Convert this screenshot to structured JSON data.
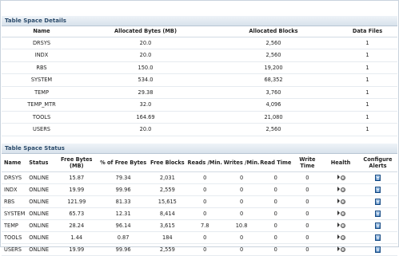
{
  "details": {
    "title": "Table Space Details",
    "headers": [
      "Name",
      "Allocated Bytes (MB)",
      "Allocated Blocks",
      "Data Files"
    ],
    "rows": [
      [
        "DRSYS",
        "20.0",
        "2,560",
        "1"
      ],
      [
        "INDX",
        "20.0",
        "2,560",
        "1"
      ],
      [
        "RBS",
        "150.0",
        "19,200",
        "1"
      ],
      [
        "SYSTEM",
        "534.0",
        "68,352",
        "1"
      ],
      [
        "TEMP",
        "29.38",
        "3,760",
        "1"
      ],
      [
        "TEMP_MTR",
        "32.0",
        "4,096",
        "1"
      ],
      [
        "TOOLS",
        "164.69",
        "21,080",
        "1"
      ],
      [
        "USERS",
        "20.0",
        "2,560",
        "1"
      ]
    ]
  },
  "status": {
    "title": "Table Space Status",
    "headers": [
      "Name",
      "Status",
      "Free Bytes (MB)",
      "% of Free Bytes",
      "Free Blocks",
      "Reads /Min.",
      "Writes /Min.",
      "Read Time",
      "Write Time",
      "Health",
      "Configure Alerts"
    ],
    "rows": [
      [
        "DRSYS",
        "ONLINE",
        "15.87",
        "79.34",
        "2,031",
        "0",
        "0",
        "0",
        "0"
      ],
      [
        "INDX",
        "ONLINE",
        "19.99",
        "99.96",
        "2,559",
        "0",
        "0",
        "0",
        "0"
      ],
      [
        "RBS",
        "ONLINE",
        "121.99",
        "81.33",
        "15,615",
        "0",
        "0",
        "0",
        "0"
      ],
      [
        "SYSTEM",
        "ONLINE",
        "65.73",
        "12.31",
        "8,414",
        "0",
        "0",
        "0",
        "0"
      ],
      [
        "TEMP",
        "ONLINE",
        "28.24",
        "96.14",
        "3,615",
        "7.8",
        "10.8",
        "0",
        "0"
      ],
      [
        "TOOLS",
        "ONLINE",
        "1.44",
        "0.87",
        "184",
        "0",
        "0",
        "0",
        "0"
      ],
      [
        "USERS",
        "ONLINE",
        "19.99",
        "99.96",
        "2,559",
        "0",
        "0",
        "0",
        "0"
      ]
    ],
    "health_icon": "health-status-icon",
    "alert_icon": "configure-alerts-icon"
  },
  "colors": {
    "title_text": "#2a4a6a",
    "title_bg": "#d8e2ec",
    "border": "#c9d3dd"
  }
}
